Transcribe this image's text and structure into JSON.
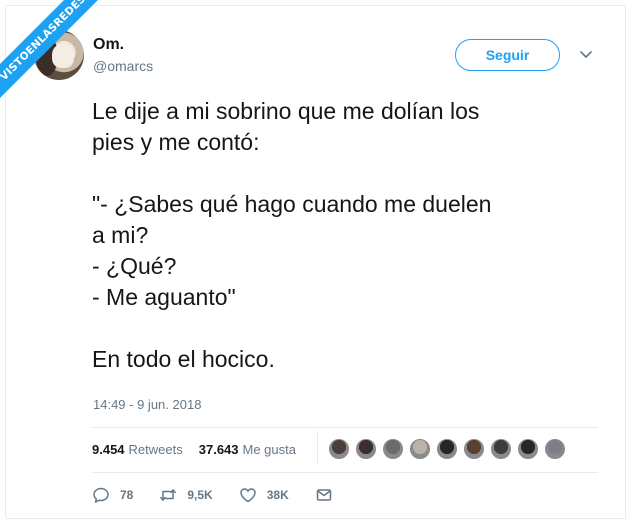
{
  "watermark": "VISTOENLASREDES",
  "user": {
    "name": "Om.",
    "handle": "@omarcs"
  },
  "follow_button": "Seguir",
  "tweet": {
    "lines": [
      "Le dije a mi sobrino que me dolían los",
      "pies y me contó:",
      "",
      "\"- ¿Sabes qué hago cuando me duelen",
      "a mi?",
      "- ¿Qué?",
      "- Me aguanto\"",
      "",
      "En todo el hocico."
    ]
  },
  "timestamp": "14:49 - 9 jun. 2018",
  "stats": {
    "retweets_count": "9.454",
    "retweets_label": "Retweets",
    "likes_count": "37.643",
    "likes_label": "Me gusta"
  },
  "likers": [
    {
      "icon": "avatar",
      "color": "#4a3f3a"
    },
    {
      "icon": "avatar",
      "color": "#3a2f2c"
    },
    {
      "icon": "avatar",
      "color": "#6b6b6b"
    },
    {
      "icon": "avatar",
      "color": "#b9b3a8"
    },
    {
      "icon": "avatar",
      "color": "#2b2421"
    },
    {
      "icon": "avatar",
      "color": "#5a4033"
    },
    {
      "icon": "avatar",
      "color": "#3d3d3d"
    },
    {
      "icon": "avatar",
      "color": "#262626"
    },
    {
      "icon": "avatar",
      "color": "#7a7f88"
    }
  ],
  "actions": {
    "replies": "78",
    "retweets": "9,5K",
    "likes": "38K"
  },
  "colors": {
    "accent": "#1da1f2",
    "secondary_text": "#657786",
    "divider": "#e6ecf0"
  }
}
